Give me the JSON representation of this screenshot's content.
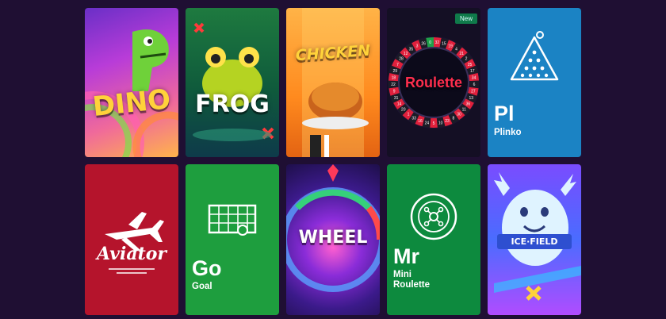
{
  "games": [
    {
      "id": "dino",
      "art_text": "DINO"
    },
    {
      "id": "frog",
      "art_text": "FROG"
    },
    {
      "id": "chicken",
      "art_text": "CHICKEN"
    },
    {
      "id": "roulette",
      "art_text": "Roulette",
      "badge": "New",
      "wheel_numbers": [
        "32",
        "15",
        "19",
        "4",
        "21",
        "2",
        "25",
        "17",
        "34",
        "6",
        "27",
        "13",
        "36",
        "11",
        "30",
        "8",
        "23",
        "10",
        "5",
        "24",
        "16",
        "33",
        "1",
        "20",
        "14",
        "31",
        "9",
        "22",
        "18",
        "29",
        "7",
        "28",
        "12",
        "35",
        "3",
        "26",
        "0"
      ]
    },
    {
      "id": "plinko",
      "abbr": "Pl",
      "name": "Plinko",
      "bg": "#1b83c4"
    },
    {
      "id": "aviator",
      "art_text": "Aviator",
      "bg": "#b5142c"
    },
    {
      "id": "goal",
      "abbr": "Go",
      "name": "Goal",
      "bg": "#1e9e3e"
    },
    {
      "id": "wheel",
      "art_text": "WHEEL"
    },
    {
      "id": "mini-roulette",
      "abbr": "Mr",
      "name": "Mini\nRoulette",
      "bg": "#0d8a3e"
    },
    {
      "id": "ice-field",
      "art_text": "ICE·FIELD"
    }
  ]
}
